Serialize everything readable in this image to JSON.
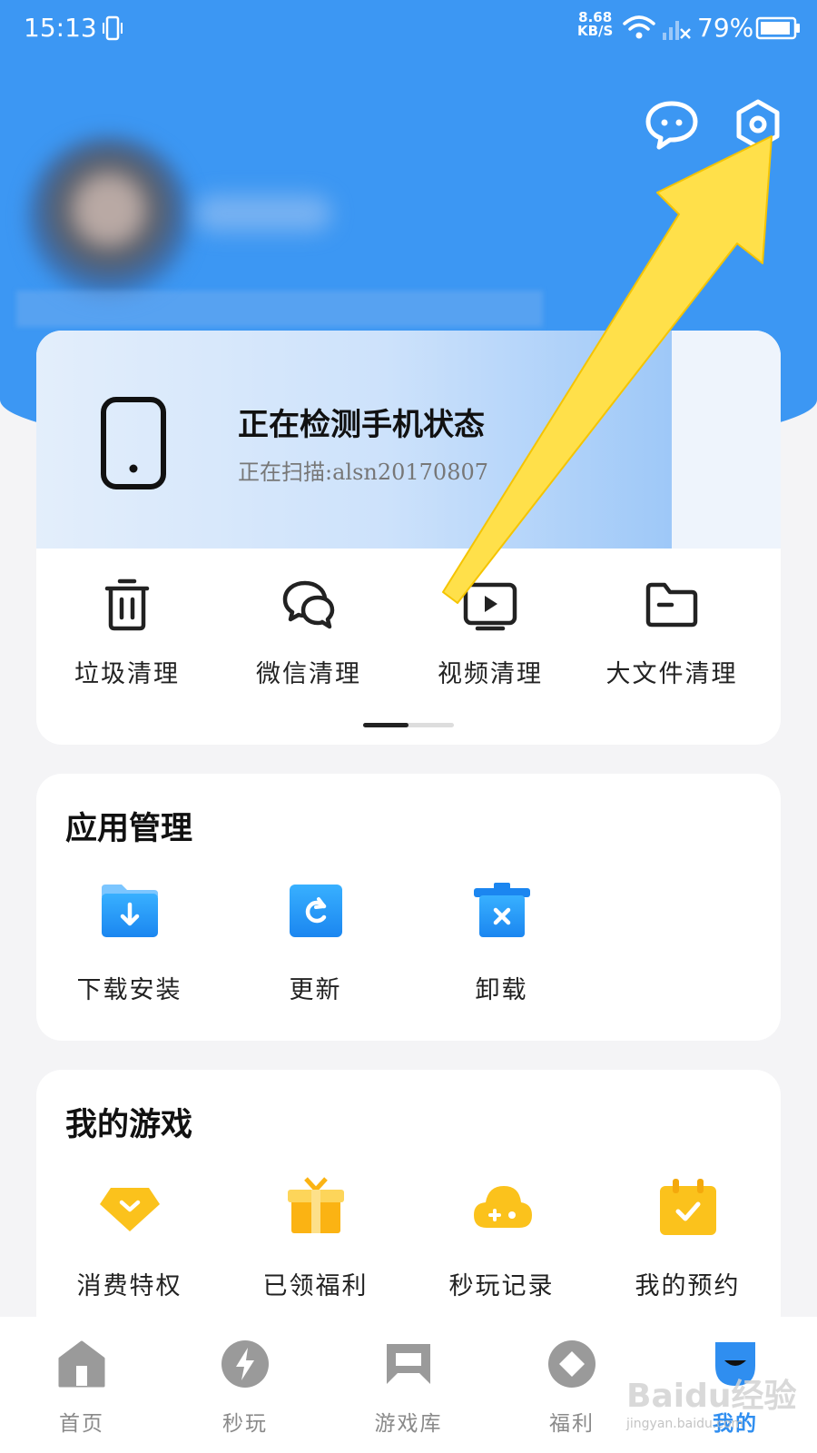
{
  "status_bar": {
    "time": "15:13",
    "net_speed_value": "8.68",
    "net_speed_unit": "KB/S",
    "battery": "79%"
  },
  "header": {
    "message_icon": "chat-bubble-icon",
    "settings_icon": "hexagon-gear-icon"
  },
  "scan": {
    "title": "正在检测手机状态",
    "subtitle": "正在扫描:alsn20170807"
  },
  "clean_tools": [
    {
      "label": "垃圾清理",
      "icon": "trash-icon"
    },
    {
      "label": "微信清理",
      "icon": "chat-icon"
    },
    {
      "label": "视频清理",
      "icon": "video-icon"
    },
    {
      "label": "大文件清理",
      "icon": "folder-icon"
    }
  ],
  "app_management": {
    "title": "应用管理",
    "items": [
      {
        "label": "下载安装",
        "icon": "download-folder-icon"
      },
      {
        "label": "更新",
        "icon": "update-icon"
      },
      {
        "label": "卸载",
        "icon": "uninstall-icon"
      }
    ]
  },
  "my_games": {
    "title": "我的游戏",
    "items": [
      {
        "label": "消费特权",
        "icon": "diamond-icon"
      },
      {
        "label": "已领福利",
        "icon": "gift-icon"
      },
      {
        "label": "秒玩记录",
        "icon": "cloud-gamepad-icon"
      },
      {
        "label": "我的预约",
        "icon": "calendar-check-icon"
      }
    ]
  },
  "bottom_nav": [
    {
      "label": "首页",
      "icon": "home-icon"
    },
    {
      "label": "秒玩",
      "icon": "lightning-icon"
    },
    {
      "label": "游戏库",
      "icon": "gamebox-icon"
    },
    {
      "label": "福利",
      "icon": "diamond-badge-icon"
    },
    {
      "label": "我的",
      "icon": "profile-icon",
      "active": true
    }
  ],
  "watermark": {
    "brand": "Baidu经验",
    "url": "jingyan.baidu.com"
  },
  "colors": {
    "header_blue": "#3c97f3",
    "accent_blue": "#2f8ef0",
    "accent_yellow": "#fbc21c"
  }
}
